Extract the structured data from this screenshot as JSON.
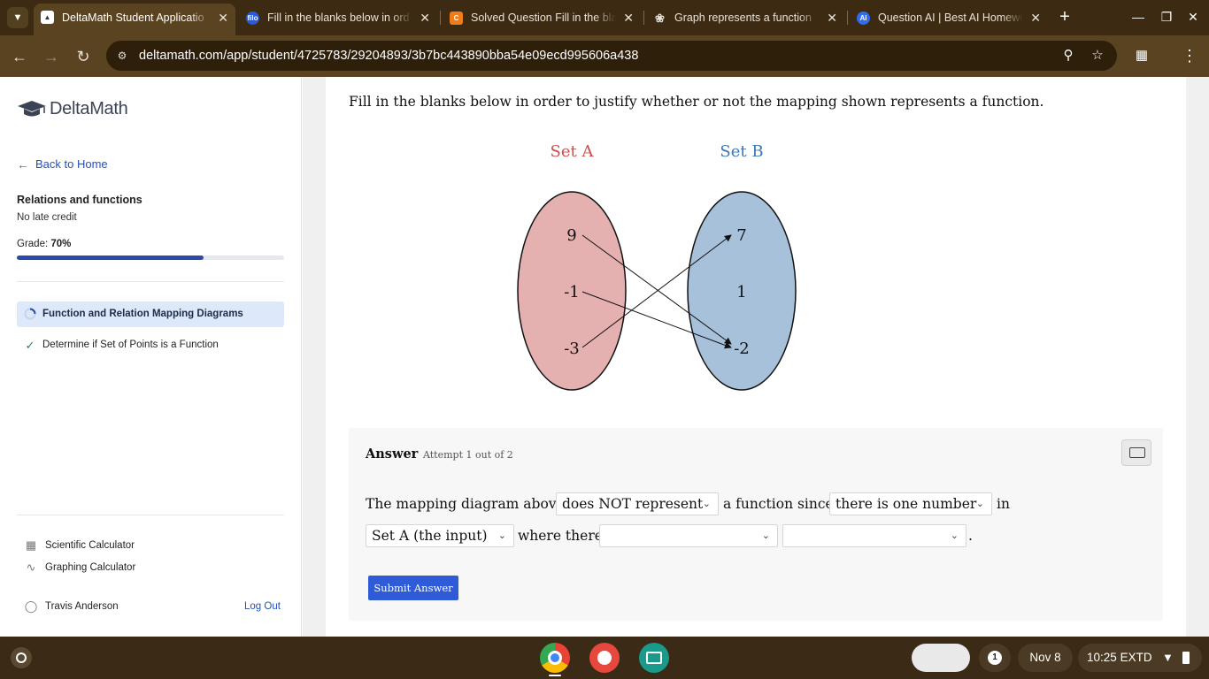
{
  "browser": {
    "tabs": [
      {
        "title": "DeltaMath Student Applicatio",
        "favicon_text": "",
        "favicon_color": "#ffffff",
        "active": true
      },
      {
        "title": "Fill in the blanks below in ord",
        "favicon_text": "filo",
        "favicon_color": "#2a5bd7",
        "active": false
      },
      {
        "title": "Solved Question Fill in the bla",
        "favicon_text": "C",
        "favicon_color": "#f07c1b",
        "active": false
      },
      {
        "title": "Graph represents a function",
        "favicon_text": "",
        "favicon_color": "#5a4320",
        "active": false
      },
      {
        "title": "Question AI | Best AI Homewo",
        "favicon_text": "AI",
        "favicon_color": "#2f6cf0",
        "active": false
      }
    ],
    "url": "deltamath.com/app/student/4725783/29204893/3b7bc443890bba54e09ecd995606a438"
  },
  "sidebar": {
    "logo_text": "DeltaMath",
    "back_label": "Back to Home",
    "assignment_title": "Relations and functions",
    "late_credit": "No late credit",
    "grade_label": "Grade:",
    "grade_value": "70%",
    "grade_fraction": 0.7,
    "problems": [
      {
        "label": "Function and Relation Mapping Diagrams",
        "status": "in-progress"
      },
      {
        "label": "Determine if Set of Points is a Function",
        "status": "complete"
      }
    ],
    "tools": [
      {
        "label": "Scientific Calculator"
      },
      {
        "label": "Graphing Calculator"
      }
    ],
    "user_name": "Travis Anderson",
    "logout_label": "Log Out"
  },
  "question": {
    "prompt": "Fill in the blanks below in order to justify whether or not the mapping shown represents a function.",
    "set_a_label": "Set A",
    "set_b_label": "Set B",
    "set_a_values": [
      "9",
      "-1",
      "-3"
    ],
    "set_b_values": [
      "7",
      "1",
      "-2"
    ],
    "set_a_color": "#e4b0b0",
    "set_b_color": "#a7c1da",
    "set_a_label_color": "#c85050",
    "set_b_label_color": "#3b78b8"
  },
  "answer": {
    "title": "Answer",
    "attempt": "Attempt 1 out of 2",
    "s1": "The mapping diagram above",
    "dd1": "does NOT represent",
    "s2": "a function since",
    "dd2": "there is one number",
    "s3": "in",
    "dd3": "Set A (the input)",
    "s4": "where there",
    "dd4": "",
    "dd5": "",
    "s5": ".",
    "submit_label": "Submit Answer"
  },
  "shelf": {
    "notification_count": "1",
    "date": "Nov 8",
    "time": "10:25",
    "timezone": "EXTD"
  }
}
